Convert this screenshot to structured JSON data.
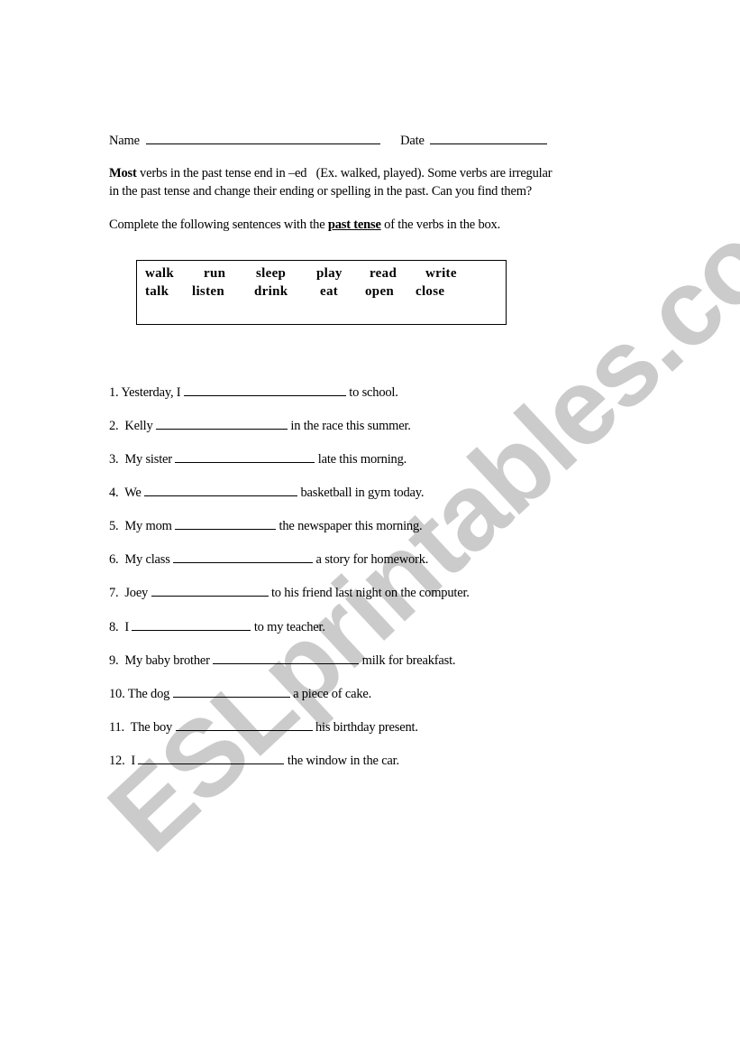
{
  "header": {
    "name_label": "Name",
    "date_label": "Date"
  },
  "intro": {
    "line1_bold": "Most",
    "line1_rest": " verbs in the past tense end in –ed   (Ex. walked, played). Some verbs are irregular",
    "line2": "in the past tense and change their ending or spelling in the past. Can you find them?"
  },
  "instruction": {
    "before": "Complete the following sentences with the ",
    "emphasis": "past tense",
    "after": " of the verbs in the box."
  },
  "verb_box": {
    "row1": [
      "walk",
      "run",
      "sleep",
      "play",
      "read",
      "write"
    ],
    "row2": [
      "talk",
      "listen",
      "drink",
      "eat",
      "open",
      "close"
    ]
  },
  "sentences": [
    {
      "prefix": "1. Yesterday, I ",
      "suffix": " to school."
    },
    {
      "prefix": "2.  Kelly ",
      "suffix": " in the race this summer."
    },
    {
      "prefix": "3.  My sister ",
      "suffix": " late this morning."
    },
    {
      "prefix": "4.  We ",
      "suffix": " basketball in gym today."
    },
    {
      "prefix": "5.  My mom ",
      "suffix": " the newspaper this morning."
    },
    {
      "prefix": "6.  My class ",
      "suffix": " a story for homework."
    },
    {
      "prefix": "7.  Joey ",
      "suffix": " to his friend last night on the computer."
    },
    {
      "prefix": "8.  I ",
      "suffix": " to my teacher."
    },
    {
      "prefix": "9.  My baby brother ",
      "suffix": " milk for breakfast."
    },
    {
      "prefix": "10. The dog ",
      "suffix": " a piece of cake."
    },
    {
      "prefix": "11.  The boy ",
      "suffix": " his birthday present."
    },
    {
      "prefix": "12.  I ",
      "suffix": " the window in the car."
    }
  ],
  "watermark": {
    "text": "ESLprintables.com",
    "color": "#c9c9c9"
  }
}
